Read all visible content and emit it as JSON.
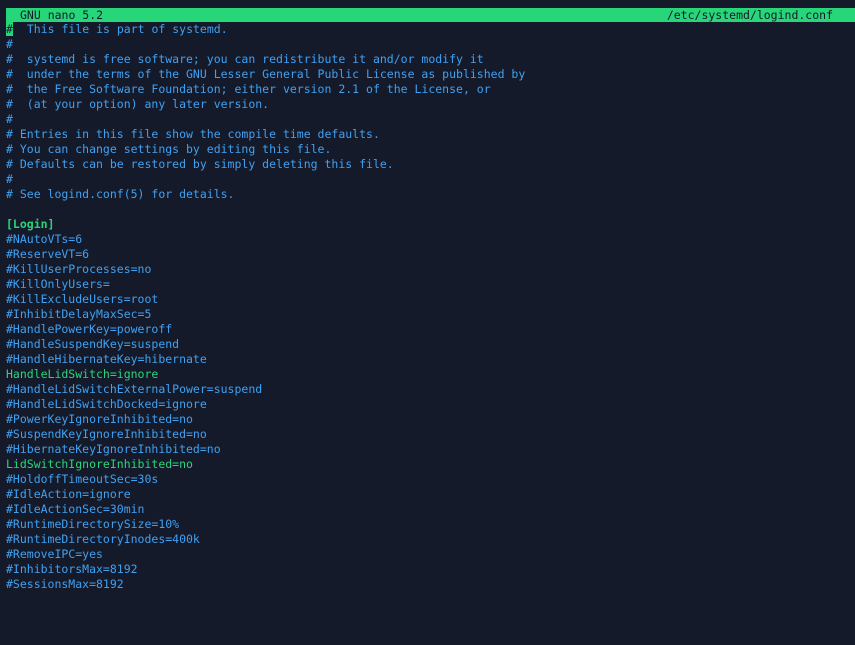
{
  "titlebar": {
    "app": "GNU nano 5.2",
    "filename": "/etc/systemd/logind.conf"
  },
  "cursor_char": "#",
  "first_line_rest": "  This file is part of systemd.",
  "lines": [
    {
      "text": "#",
      "kind": "comment"
    },
    {
      "text": "#  systemd is free software; you can redistribute it and/or modify it",
      "kind": "comment"
    },
    {
      "text": "#  under the terms of the GNU Lesser General Public License as published by",
      "kind": "comment"
    },
    {
      "text": "#  the Free Software Foundation; either version 2.1 of the License, or",
      "kind": "comment"
    },
    {
      "text": "#  (at your option) any later version.",
      "kind": "comment"
    },
    {
      "text": "#",
      "kind": "comment"
    },
    {
      "text": "# Entries in this file show the compile time defaults.",
      "kind": "comment"
    },
    {
      "text": "# You can change settings by editing this file.",
      "kind": "comment"
    },
    {
      "text": "# Defaults can be restored by simply deleting this file.",
      "kind": "comment"
    },
    {
      "text": "#",
      "kind": "comment"
    },
    {
      "text": "# See logind.conf(5) for details.",
      "kind": "comment"
    },
    {
      "text": "",
      "kind": "comment"
    },
    {
      "text": "[Login]",
      "kind": "section"
    },
    {
      "text": "#NAutoVTs=6",
      "kind": "comment"
    },
    {
      "text": "#ReserveVT=6",
      "kind": "comment"
    },
    {
      "text": "#KillUserProcesses=no",
      "kind": "comment"
    },
    {
      "text": "#KillOnlyUsers=",
      "kind": "comment"
    },
    {
      "text": "#KillExcludeUsers=root",
      "kind": "comment"
    },
    {
      "text": "#InhibitDelayMaxSec=5",
      "kind": "comment"
    },
    {
      "text": "#HandlePowerKey=poweroff",
      "kind": "comment"
    },
    {
      "text": "#HandleSuspendKey=suspend",
      "kind": "comment"
    },
    {
      "text": "#HandleHibernateKey=hibernate",
      "kind": "comment"
    },
    {
      "text": "HandleLidSwitch=ignore",
      "kind": "active"
    },
    {
      "text": "#HandleLidSwitchExternalPower=suspend",
      "kind": "comment"
    },
    {
      "text": "#HandleLidSwitchDocked=ignore",
      "kind": "comment"
    },
    {
      "text": "#PowerKeyIgnoreInhibited=no",
      "kind": "comment"
    },
    {
      "text": "#SuspendKeyIgnoreInhibited=no",
      "kind": "comment"
    },
    {
      "text": "#HibernateKeyIgnoreInhibited=no",
      "kind": "comment"
    },
    {
      "text": "LidSwitchIgnoreInhibited=no",
      "kind": "active"
    },
    {
      "text": "#HoldoffTimeoutSec=30s",
      "kind": "comment"
    },
    {
      "text": "#IdleAction=ignore",
      "kind": "comment"
    },
    {
      "text": "#IdleActionSec=30min",
      "kind": "comment"
    },
    {
      "text": "#RuntimeDirectorySize=10%",
      "kind": "comment"
    },
    {
      "text": "#RuntimeDirectoryInodes=400k",
      "kind": "comment"
    },
    {
      "text": "#RemoveIPC=yes",
      "kind": "comment"
    },
    {
      "text": "#InhibitorsMax=8192",
      "kind": "comment"
    },
    {
      "text": "#SessionsMax=8192",
      "kind": "comment"
    }
  ],
  "colors": {
    "background": "#151a2b",
    "comment": "#3fa1f2",
    "accent_green": "#28d67a"
  }
}
